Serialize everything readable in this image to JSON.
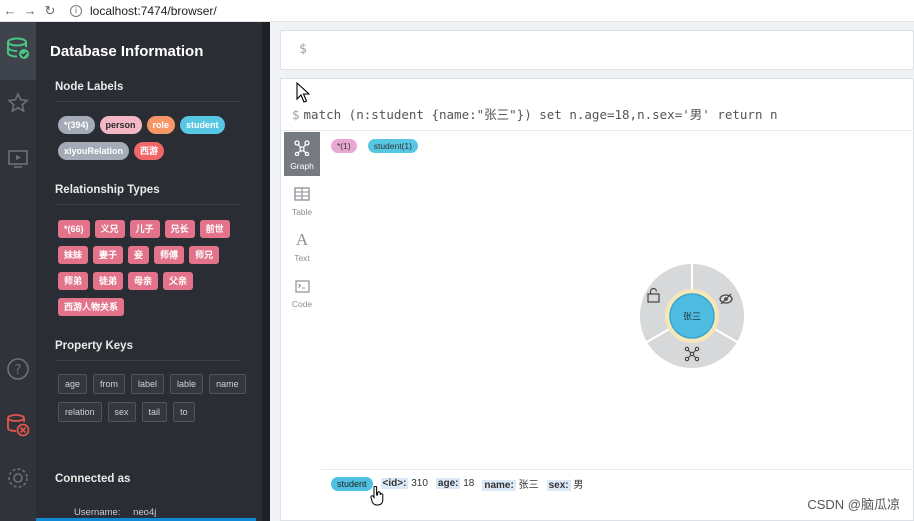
{
  "browser": {
    "url": "localhost:7474/browser/"
  },
  "drawer": {
    "title": "Database Information",
    "node_labels_title": "Node Labels",
    "node_labels": [
      {
        "label": "*(394)",
        "color": "#a5abb6"
      },
      {
        "label": "person",
        "color": "#f4b7c6"
      },
      {
        "label": "role",
        "color": "#f79767"
      },
      {
        "label": "student",
        "color": "#57c7e3"
      },
      {
        "label": "xiyouRelation",
        "color": "#a5abb6"
      },
      {
        "label": "西游",
        "color": "#f16667"
      }
    ],
    "relationship_types_title": "Relationship Types",
    "relationship_types": [
      "*(66)",
      "义兄",
      "儿子",
      "兄长",
      "前世",
      "妹妹",
      "妻子",
      "妾",
      "师傅",
      "师兄",
      "师弟",
      "徒弟",
      "母亲",
      "父亲",
      "西游人物关系"
    ],
    "property_keys_title": "Property Keys",
    "property_keys": [
      "age",
      "from",
      "label",
      "lable",
      "name",
      "relation",
      "sex",
      "tail",
      "to"
    ],
    "connected_as_title": "Connected as",
    "username_label": "Username:",
    "username": "neo4j"
  },
  "editor": {
    "prompt": "$"
  },
  "frame": {
    "command_prompt": "$",
    "command": "match (n:student {name:\"张三\"}) set n.age=18,n.sex='男' return n",
    "view_tabs": [
      {
        "label": "Graph",
        "icon": "graph-icon",
        "active": true
      },
      {
        "label": "Table",
        "icon": "table-icon",
        "active": false
      },
      {
        "label": "Text",
        "icon": "text-icon",
        "active": false
      },
      {
        "label": "Code",
        "icon": "code-icon",
        "active": false
      }
    ],
    "overview": [
      {
        "label": "*(1)",
        "color": "#e9a8d2"
      },
      {
        "label": "student(1)",
        "color": "#57c7e3"
      }
    ],
    "node": {
      "caption": "张三",
      "color": "#4fbde3"
    },
    "status": {
      "label": "student",
      "props": [
        {
          "key": "<id>:",
          "value": "310"
        },
        {
          "key": "age:",
          "value": "18"
        },
        {
          "key": "name:",
          "value": "张三"
        },
        {
          "key": "sex:",
          "value": "男"
        }
      ]
    }
  },
  "watermark": "CSDN @脑瓜凉"
}
